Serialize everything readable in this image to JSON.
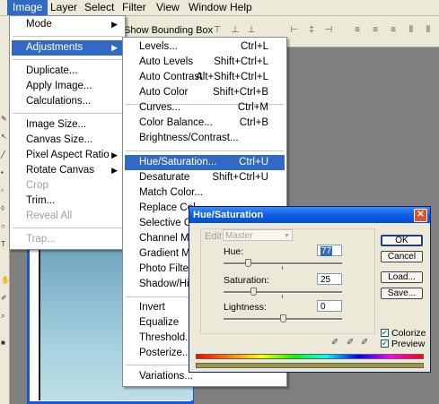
{
  "menubar": {
    "items": [
      "Image",
      "Layer",
      "Select",
      "Filter",
      "View",
      "Window",
      "Help"
    ]
  },
  "options_bar": {
    "show_bounding_box": "Show Bounding Box"
  },
  "image_menu": {
    "items": [
      {
        "label": "Mode",
        "submenu": true
      },
      {
        "label": "Adjustments",
        "submenu": true
      },
      {
        "label": "Duplicate..."
      },
      {
        "label": "Apply Image..."
      },
      {
        "label": "Calculations..."
      },
      {
        "label": "Image Size..."
      },
      {
        "label": "Canvas Size..."
      },
      {
        "label": "Pixel Aspect Ratio",
        "submenu": true
      },
      {
        "label": "Rotate Canvas",
        "submenu": true
      },
      {
        "label": "Crop",
        "disabled": true
      },
      {
        "label": "Trim..."
      },
      {
        "label": "Reveal All",
        "disabled": true
      },
      {
        "label": "Trap...",
        "disabled": true
      }
    ]
  },
  "adjustments_menu": {
    "items": [
      {
        "label": "Levels...",
        "shortcut": "Ctrl+L"
      },
      {
        "label": "Auto Levels",
        "shortcut": "Shift+Ctrl+L"
      },
      {
        "label": "Auto Contrast",
        "shortcut": "Alt+Shift+Ctrl+L"
      },
      {
        "label": "Auto Color",
        "shortcut": "Shift+Ctrl+B"
      },
      {
        "label": "Curves...",
        "shortcut": "Ctrl+M"
      },
      {
        "label": "Color Balance...",
        "shortcut": "Ctrl+B"
      },
      {
        "label": "Brightness/Contrast...",
        "shortcut": ""
      },
      {
        "label": "Hue/Saturation...",
        "shortcut": "Ctrl+U"
      },
      {
        "label": "Desaturate",
        "shortcut": "Shift+Ctrl+U"
      },
      {
        "label": "Match Color...",
        "shortcut": ""
      },
      {
        "label": "Replace Col",
        "shortcut": ""
      },
      {
        "label": "Selective Co",
        "shortcut": ""
      },
      {
        "label": "Channel Mix",
        "shortcut": ""
      },
      {
        "label": "Gradient Ma",
        "shortcut": ""
      },
      {
        "label": "Photo Filter...",
        "shortcut": ""
      },
      {
        "label": "Shadow/Hig",
        "shortcut": ""
      },
      {
        "label": "Invert",
        "shortcut": ""
      },
      {
        "label": "Equalize",
        "shortcut": ""
      },
      {
        "label": "Threshold...",
        "shortcut": ""
      },
      {
        "label": "Posterize...",
        "shortcut": ""
      },
      {
        "label": "Variations...",
        "shortcut": ""
      }
    ]
  },
  "dialog": {
    "title": "Hue/Saturation",
    "edit_label": "Edit:",
    "edit_value": "Master",
    "hue_label": "Hue:",
    "hue_value": "77",
    "saturation_label": "Saturation:",
    "saturation_value": "25",
    "lightness_label": "Lightness:",
    "lightness_value": "0",
    "ok": "OK",
    "cancel": "Cancel",
    "load": "Load...",
    "save": "Save...",
    "colorize": "Colorize",
    "preview": "Preview",
    "colorize_checked": true,
    "preview_checked": true
  }
}
